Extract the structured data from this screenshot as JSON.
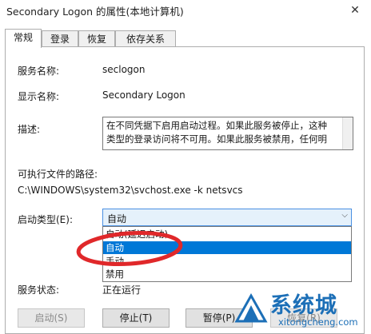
{
  "window": {
    "title": "Secondary Logon 的属性(本地计算机)",
    "close_glyph": "✕"
  },
  "tabs": [
    {
      "label": "常规",
      "active": true
    },
    {
      "label": "登录",
      "active": false
    },
    {
      "label": "恢复",
      "active": false
    },
    {
      "label": "依存关系",
      "active": false
    }
  ],
  "general": {
    "service_name_label": "服务名称:",
    "service_name": "seclogon",
    "display_name_label": "显示名称:",
    "display_name": "Secondary Logon",
    "description_label": "描述:",
    "description_lines": [
      "在不同凭据下启用启动过程。如果此服务被停止，这种",
      "类型的登录访问将不可用。如果此服务被禁用，任何明"
    ],
    "exe_path_label": "可执行文件的路径:",
    "exe_path": "C:\\WINDOWS\\system32\\svchost.exe -k netsvcs",
    "startup_type_label": "启动类型(E):",
    "startup_type_value": "自动",
    "startup_options": [
      {
        "label": "自动(延迟启动)",
        "selected": false
      },
      {
        "label": "自动",
        "selected": true
      },
      {
        "label": "手动",
        "selected": false
      },
      {
        "label": "禁用",
        "selected": false
      }
    ],
    "service_status_label": "服务状态:",
    "service_status": "正在运行"
  },
  "buttons": {
    "start": "启动(S)",
    "stop": "停止(T)",
    "pause": "暂停(P)",
    "resume": "恢复(R)"
  },
  "annotation": {
    "circle_color": "#e0282a"
  },
  "watermark": {
    "brand": "系统城",
    "url": "xitongcheng.com",
    "color": "#1c6fb7"
  }
}
